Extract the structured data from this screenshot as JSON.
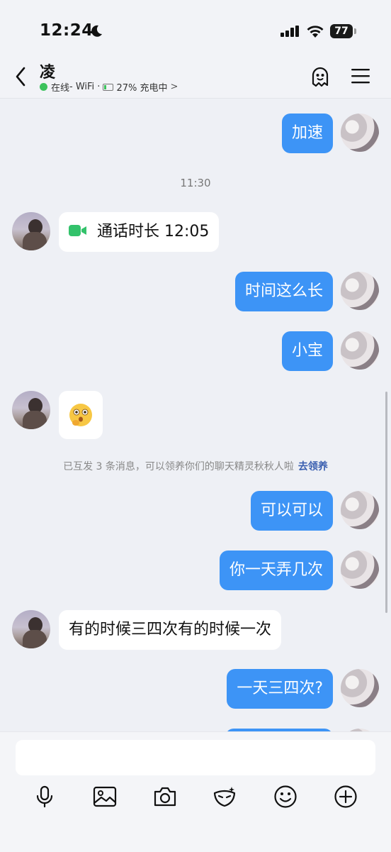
{
  "status_bar": {
    "time": "12:24",
    "battery": "77"
  },
  "header": {
    "name": "凌",
    "status_online": "在线",
    "status_network": " - WiFi · ",
    "status_battery": "27% 充电中"
  },
  "chat": {
    "messages": [
      {
        "side": "mine",
        "text": "加速"
      },
      {
        "type": "timestamp",
        "text": "11:30"
      },
      {
        "side": "peer",
        "type": "call",
        "text": "通话时长 12:05"
      },
      {
        "side": "mine",
        "text": "时间这么长"
      },
      {
        "side": "mine",
        "text": "小宝"
      },
      {
        "side": "peer",
        "type": "emoji",
        "emoji": "🤔"
      },
      {
        "type": "system",
        "text": "已互发 3 条消息，可以领养你们的聊天精灵秋秋人啦",
        "link": "去领养"
      },
      {
        "side": "mine",
        "text": "可以可以"
      },
      {
        "side": "mine",
        "text": "你一天弄几次"
      },
      {
        "side": "peer",
        "text": "有的时候三四次有的时候一次"
      },
      {
        "side": "mine",
        "text": "一天三四次?"
      }
    ]
  },
  "input": {
    "placeholder": ""
  },
  "toolbar": {
    "icons": [
      "microphone-icon",
      "image-icon",
      "camera-icon",
      "mask-icon",
      "emoji-icon",
      "plus-icon"
    ]
  },
  "colors": {
    "my_bubble": "#3d94f6",
    "peer_bubble": "#ffffff",
    "background": "#eef0f5"
  }
}
